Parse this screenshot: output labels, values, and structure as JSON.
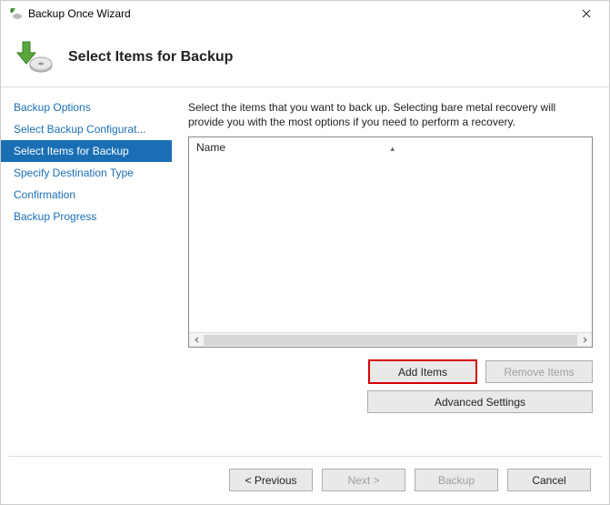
{
  "window": {
    "title": "Backup Once Wizard"
  },
  "header": {
    "title": "Select Items for Backup"
  },
  "sidebar": {
    "items": [
      {
        "label": "Backup Options",
        "active": false
      },
      {
        "label": "Select Backup Configurat...",
        "active": false
      },
      {
        "label": "Select Items for Backup",
        "active": true
      },
      {
        "label": "Specify Destination Type",
        "active": false
      },
      {
        "label": "Confirmation",
        "active": false
      },
      {
        "label": "Backup Progress",
        "active": false
      }
    ]
  },
  "main": {
    "instruction": "Select the items that you want to back up. Selecting bare metal recovery will provide you with the most options if you need to perform a recovery.",
    "column_header": "Name",
    "buttons": {
      "add_items": "Add Items",
      "remove_items": "Remove Items",
      "advanced_settings": "Advanced Settings"
    }
  },
  "footer": {
    "previous": "< Previous",
    "next": "Next >",
    "backup": "Backup",
    "cancel": "Cancel"
  }
}
